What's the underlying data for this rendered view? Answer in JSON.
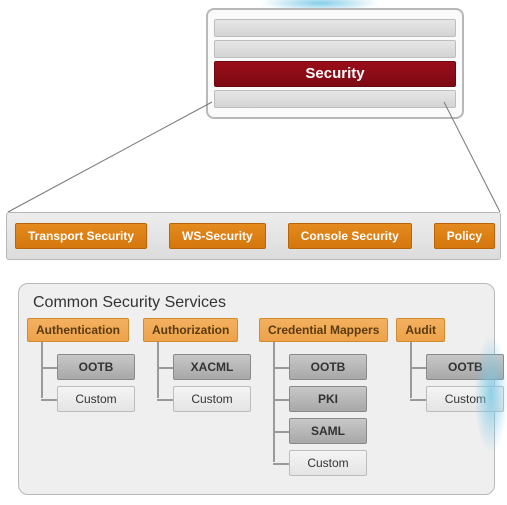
{
  "top_stack": {
    "highlight_label": "Security"
  },
  "security_bar": {
    "items": [
      "Transport Security",
      "WS-Security",
      "Console Security",
      "Policy"
    ]
  },
  "common": {
    "title": "Common Security Services",
    "columns": [
      {
        "header": "Authentication",
        "children": [
          {
            "label": "OOTB",
            "style": "dark"
          },
          {
            "label": "Custom",
            "style": "light"
          }
        ]
      },
      {
        "header": "Authorization",
        "children": [
          {
            "label": "XACML",
            "style": "dark"
          },
          {
            "label": "Custom",
            "style": "light"
          }
        ]
      },
      {
        "header": "Credential Mappers",
        "children": [
          {
            "label": "OOTB",
            "style": "dark"
          },
          {
            "label": "PKI",
            "style": "dark"
          },
          {
            "label": "SAML",
            "style": "dark"
          },
          {
            "label": "Custom",
            "style": "light"
          }
        ]
      },
      {
        "header": "Audit",
        "children": [
          {
            "label": "OOTB",
            "style": "dark"
          },
          {
            "label": "Custom",
            "style": "light"
          }
        ]
      }
    ]
  }
}
